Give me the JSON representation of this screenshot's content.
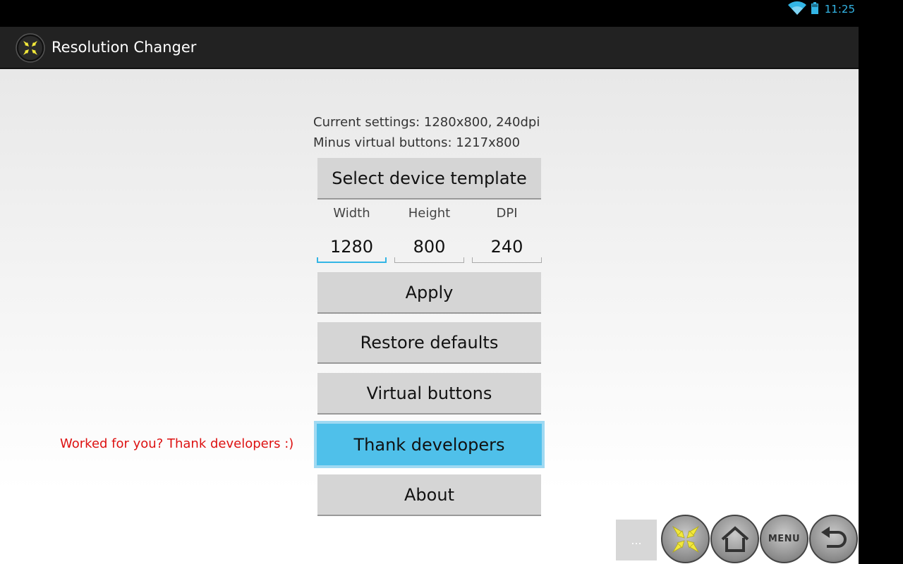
{
  "status_bar": {
    "time": "11:25",
    "icons": [
      "wifi-icon",
      "battery-icon"
    ]
  },
  "app": {
    "title": "Resolution Changer",
    "icon": "compress-arrows-icon"
  },
  "info": {
    "current_settings": "Current settings: 1280x800, 240dpi",
    "minus_virtual": "Minus virtual buttons: 1217x800"
  },
  "buttons": {
    "select_template": "Select device template",
    "apply": "Apply",
    "restore_defaults": "Restore defaults",
    "virtual_buttons": "Virtual buttons",
    "thank_developers": "Thank developers",
    "about": "About"
  },
  "fields": {
    "width": {
      "label": "Width",
      "value": "1280"
    },
    "height": {
      "label": "Height",
      "value": "800"
    },
    "dpi": {
      "label": "DPI",
      "value": "240"
    }
  },
  "thanks_note": "Worked for you? Thank developers :)",
  "virtual_nav": {
    "more_label": "...",
    "menu_label": "MENU",
    "icons": [
      "compress-arrows-icon",
      "home-icon",
      "menu-icon",
      "back-icon"
    ]
  },
  "colors": {
    "accent": "#33b5e5",
    "highlight_button": "#4fc0ea",
    "note_text": "#dd1111"
  }
}
